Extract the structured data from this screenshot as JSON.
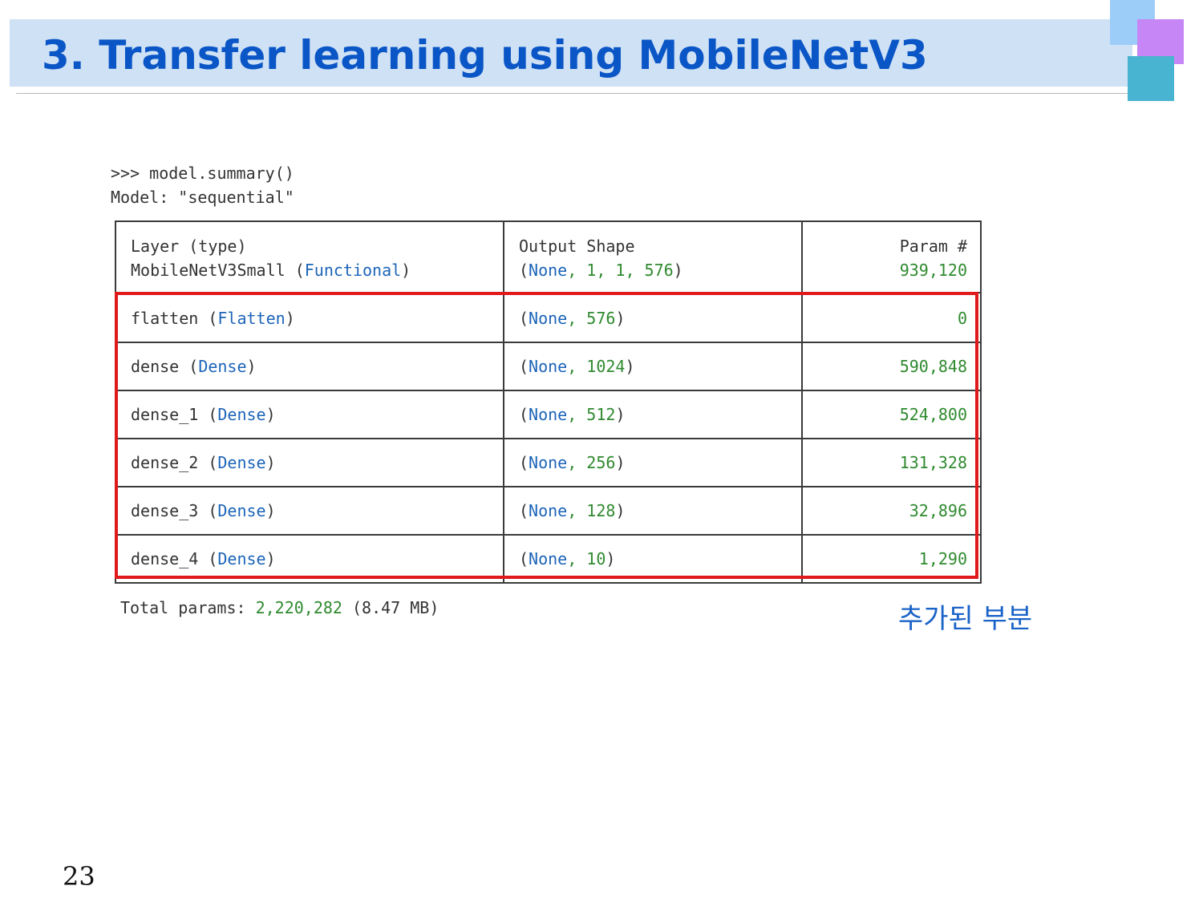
{
  "slide": {
    "title": "3. Transfer learning using MobileNetV3",
    "page_number": "23",
    "annotation": "추가된 부분"
  },
  "code": {
    "prompt": ">>> model.summary()",
    "model_label": "Model: \"sequential\"",
    "total_prefix": "Total params: ",
    "total_value": "2,220,282",
    "total_suffix": " (8.47 MB)"
  },
  "table": {
    "headers": {
      "layer": "Layer (type)",
      "output": "Output Shape",
      "params": "Param #"
    },
    "rows": [
      {
        "name": "MobileNetV3Small",
        "type": "Functional",
        "none": "None",
        "shape": ", 1, 1, 576",
        "params": "939,120"
      },
      {
        "name": "flatten",
        "type": "Flatten",
        "none": "None",
        "shape": ", 576",
        "params": "0"
      },
      {
        "name": "dense",
        "type": "Dense",
        "none": "None",
        "shape": ", 1024",
        "params": "590,848"
      },
      {
        "name": "dense_1",
        "type": "Dense",
        "none": "None",
        "shape": ", 512",
        "params": "524,800"
      },
      {
        "name": "dense_2",
        "type": "Dense",
        "none": "None",
        "shape": ", 256",
        "params": "131,328"
      },
      {
        "name": "dense_3",
        "type": "Dense",
        "none": "None",
        "shape": ", 128",
        "params": "32,896"
      },
      {
        "name": "dense_4",
        "type": "Dense",
        "none": "None",
        "shape": ", 10",
        "params": "1,290"
      }
    ]
  },
  "colors": {
    "title_text": "#0a56c6",
    "title_band": "#cfe1f5",
    "highlight_border": "#e0191b",
    "keyword_blue": "#1c64b8",
    "number_green": "#2f8a2f"
  }
}
